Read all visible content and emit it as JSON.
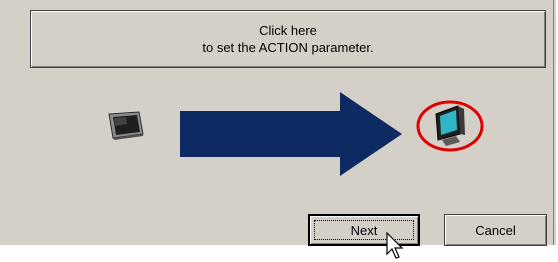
{
  "action_button": {
    "line1": "Click here",
    "line2": "to set the ACTION parameter."
  },
  "buttons": {
    "next": "Next",
    "cancel": "Cancel"
  },
  "icons": {
    "source": "panel-display-icon",
    "arrow": "transfer-arrow-icon",
    "target": "pc-monitor-icon",
    "highlight": "red-circle-highlight",
    "cursor": "mouse-pointer-icon"
  },
  "colors": {
    "arrow": "#0e2a62",
    "highlight": "#e00000",
    "background": "#d4d0c8"
  }
}
